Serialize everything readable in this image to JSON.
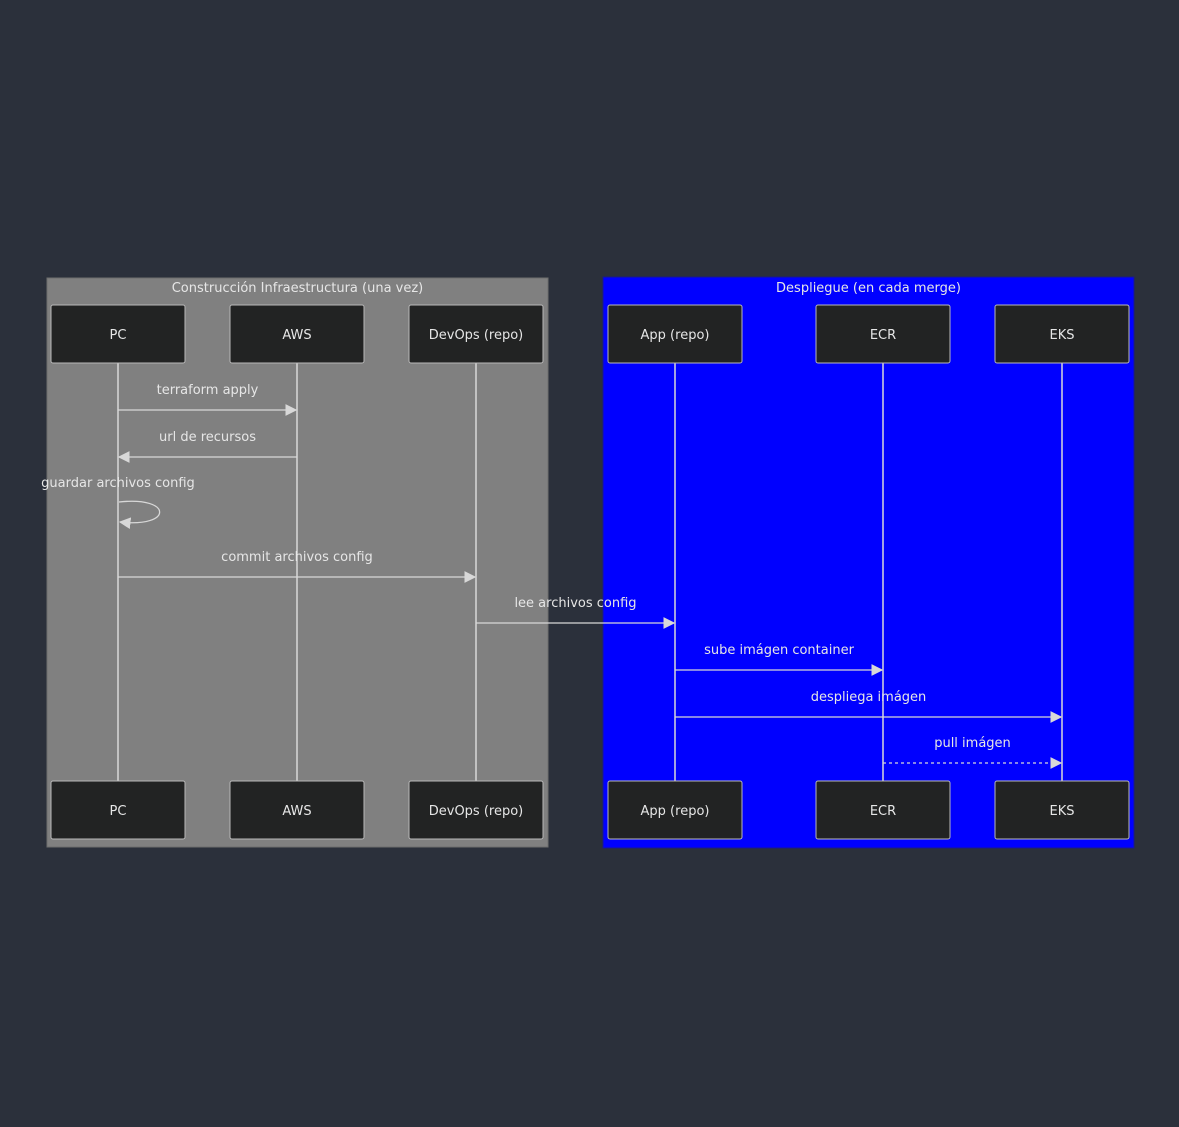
{
  "diagram": {
    "type": "sequence",
    "groups": [
      {
        "id": "infra",
        "title": "Construcción Infraestructura (una vez)",
        "color": "#808080",
        "actors": [
          "pc",
          "aws",
          "devops"
        ]
      },
      {
        "id": "deploy",
        "title": "Despliegue (en cada merge)",
        "color": "#0000ff",
        "actors": [
          "app",
          "ecr",
          "eks"
        ]
      }
    ],
    "actors": [
      {
        "id": "pc",
        "label": "PC"
      },
      {
        "id": "aws",
        "label": "AWS"
      },
      {
        "id": "devops",
        "label": "DevOps (repo)"
      },
      {
        "id": "app",
        "label": "App (repo)"
      },
      {
        "id": "ecr",
        "label": "ECR"
      },
      {
        "id": "eks",
        "label": "EKS"
      }
    ],
    "messages": [
      {
        "from": "pc",
        "to": "aws",
        "label": "terraform apply",
        "style": "solid"
      },
      {
        "from": "aws",
        "to": "pc",
        "label": "url de recursos",
        "style": "solid"
      },
      {
        "from": "pc",
        "to": "pc",
        "label": "guardar archivos config",
        "style": "self"
      },
      {
        "from": "pc",
        "to": "devops",
        "label": "commit archivos config",
        "style": "solid"
      },
      {
        "from": "devops",
        "to": "app",
        "label": "lee archivos config",
        "style": "solid"
      },
      {
        "from": "app",
        "to": "ecr",
        "label": "sube imágen container",
        "style": "solid"
      },
      {
        "from": "app",
        "to": "eks",
        "label": "despliega imágen",
        "style": "solid"
      },
      {
        "from": "ecr",
        "to": "eks",
        "label": "pull imágen",
        "style": "dashed"
      }
    ],
    "colors": {
      "background": "#2b303b",
      "actor_fill": "#222323",
      "line": "#d8d8d8",
      "text": "#e6e6e6"
    }
  }
}
